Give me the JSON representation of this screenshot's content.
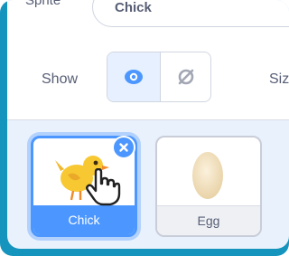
{
  "header": {
    "sprite_label": "Sprite",
    "sprite_name_value": "Chick"
  },
  "visibility": {
    "show_label": "Show",
    "visible_icon": "eye-icon",
    "hidden_icon": "eye-slash-icon",
    "size_label": "Size"
  },
  "sprites": [
    {
      "name": "Chick",
      "selected": true,
      "thumbnail_icon": "chick-icon"
    },
    {
      "name": "Egg",
      "selected": false,
      "thumbnail_icon": "egg-icon"
    }
  ],
  "colors": {
    "frame": "#1594bd",
    "accent": "#4c97ff",
    "text": "#575e75"
  }
}
